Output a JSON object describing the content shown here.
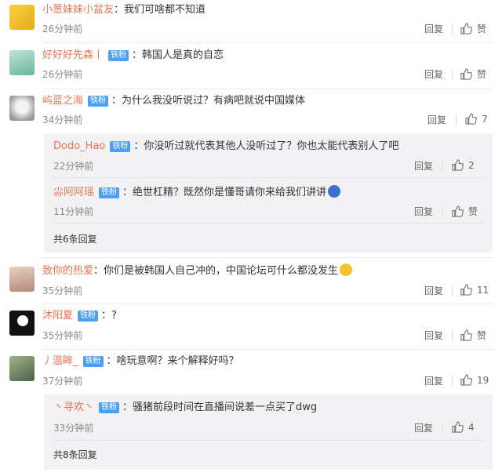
{
  "colors": {
    "username": "#eb7350",
    "badge": "#4d9ff5",
    "time": "#888888",
    "sub_background": "#f2f2f5"
  },
  "actions": {
    "reply_label": "回复"
  },
  "comments": [
    {
      "user": "小葱妹妹小盆友",
      "badge": "",
      "sep": "：",
      "text": "我们可啥都不知道",
      "time": "26分钟前",
      "like": "赞"
    },
    {
      "user": "好好好先森丨",
      "badge": "铁粉",
      "sep": "：",
      "text": "韩国人是真的自恋",
      "time": "26分钟前",
      "like": "赞"
    },
    {
      "user": "屿蓝之海",
      "badge": "铁粉",
      "sep": "：",
      "text": "为什么我没听说过？有病吧就说中国媒体",
      "time": "34分钟前",
      "like": "7"
    },
    {
      "user": "致你的热爱",
      "badge": "",
      "sep": "：",
      "text": "你们是被韩国人自己冲的，中国论坛可什么都没发生",
      "time": "35分钟前",
      "like": "11"
    },
    {
      "user": "沐阳夏",
      "badge": "铁粉",
      "sep": "：",
      "text": "?",
      "time": "35分钟前",
      "like": "赞"
    },
    {
      "user": "丿温眸_",
      "badge": "铁粉",
      "sep": "：",
      "text": "啥玩意啊？来个解释好吗？",
      "time": "37分钟前",
      "like": "19"
    }
  ],
  "subreplies": [
    {
      "user": "Dodo_Hao",
      "badge": "铁粉",
      "sep": "：",
      "text": "你没听过就代表其他人没听过了？你也太能代表别人了吧",
      "time": "22分钟前",
      "like": "2"
    },
    {
      "user": "尛阿阿瑶",
      "badge": "铁粉",
      "sep": "：",
      "text": "绝世杠精？既然你是懂哥请你来给我们讲讲",
      "time": "11分钟前",
      "like": "赞"
    },
    {
      "user": "丶寻欢丶",
      "badge": "铁粉",
      "sep": "：",
      "text": "骚猪前段时间在直播间说差一点买了dwg",
      "time": "33分钟前",
      "like": "4"
    }
  ],
  "more_replies": [
    "共6条回复",
    "共8条回复"
  ],
  "icons": {
    "like": "thumbs-up-icon",
    "avatar": "user-avatar"
  }
}
